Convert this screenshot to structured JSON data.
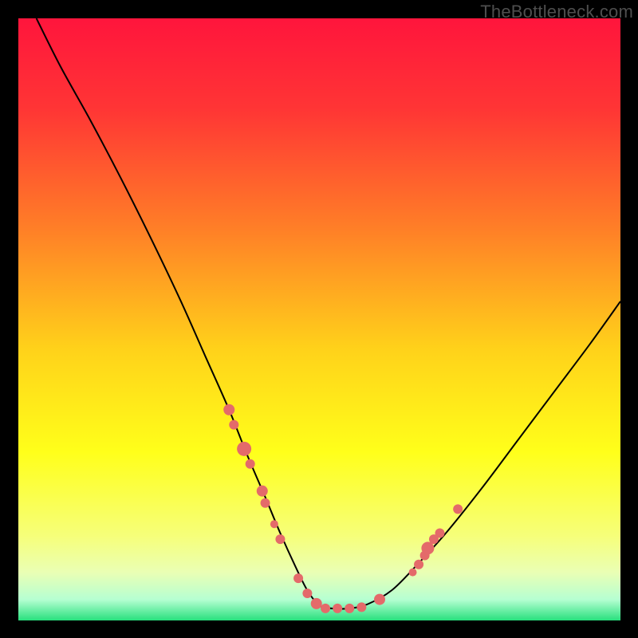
{
  "watermark": "TheBottleneck.com",
  "chart_data": {
    "type": "line",
    "title": "",
    "xlabel": "",
    "ylabel": "",
    "xlim": [
      0,
      100
    ],
    "ylim": [
      0,
      100
    ],
    "grid": false,
    "legend": false,
    "background_gradient": {
      "stops": [
        {
          "offset": 0.0,
          "color": "#ff153c"
        },
        {
          "offset": 0.15,
          "color": "#ff3535"
        },
        {
          "offset": 0.35,
          "color": "#ff7f27"
        },
        {
          "offset": 0.55,
          "color": "#ffd21a"
        },
        {
          "offset": 0.72,
          "color": "#ffff1a"
        },
        {
          "offset": 0.86,
          "color": "#f6ff7a"
        },
        {
          "offset": 0.92,
          "color": "#eaffb4"
        },
        {
          "offset": 0.965,
          "color": "#b6ffd2"
        },
        {
          "offset": 1.0,
          "color": "#28e07d"
        }
      ]
    },
    "series": [
      {
        "name": "bottleneck-curve",
        "color": "#000000",
        "x": [
          3,
          7,
          12,
          17,
          22,
          27,
          31,
          35,
          38,
          41,
          43.5,
          46,
          48,
          50,
          52,
          55,
          58,
          62,
          66,
          71,
          77,
          83,
          89,
          95,
          100
        ],
        "y": [
          100,
          92,
          83,
          73.5,
          63.5,
          53,
          44,
          35,
          27.5,
          20.5,
          14.5,
          9,
          5,
          2.5,
          2,
          2,
          2.7,
          5,
          9,
          14.5,
          22,
          30,
          38,
          46,
          53
        ]
      }
    ],
    "markers": {
      "name": "highlighted-points",
      "color": "#e46a6a",
      "radius_range": [
        5,
        9
      ],
      "points": [
        {
          "x": 35.0,
          "y": 35.0,
          "r": 7
        },
        {
          "x": 35.8,
          "y": 32.5,
          "r": 6
        },
        {
          "x": 37.5,
          "y": 28.5,
          "r": 9
        },
        {
          "x": 38.5,
          "y": 26.0,
          "r": 6
        },
        {
          "x": 40.5,
          "y": 21.5,
          "r": 7
        },
        {
          "x": 41.0,
          "y": 19.5,
          "r": 6
        },
        {
          "x": 42.5,
          "y": 16.0,
          "r": 5
        },
        {
          "x": 43.5,
          "y": 13.5,
          "r": 6
        },
        {
          "x": 46.5,
          "y": 7.0,
          "r": 6
        },
        {
          "x": 48.0,
          "y": 4.5,
          "r": 6
        },
        {
          "x": 49.5,
          "y": 2.8,
          "r": 7
        },
        {
          "x": 51.0,
          "y": 2.0,
          "r": 6
        },
        {
          "x": 53.0,
          "y": 2.0,
          "r": 6
        },
        {
          "x": 55.0,
          "y": 2.0,
          "r": 6
        },
        {
          "x": 57.0,
          "y": 2.2,
          "r": 6
        },
        {
          "x": 60.0,
          "y": 3.5,
          "r": 7
        },
        {
          "x": 65.5,
          "y": 8.0,
          "r": 5
        },
        {
          "x": 66.5,
          "y": 9.3,
          "r": 6
        },
        {
          "x": 67.5,
          "y": 10.8,
          "r": 6
        },
        {
          "x": 68.0,
          "y": 12.0,
          "r": 8
        },
        {
          "x": 69.0,
          "y": 13.5,
          "r": 6
        },
        {
          "x": 70.0,
          "y": 14.5,
          "r": 6
        },
        {
          "x": 73.0,
          "y": 18.5,
          "r": 6
        }
      ]
    }
  }
}
